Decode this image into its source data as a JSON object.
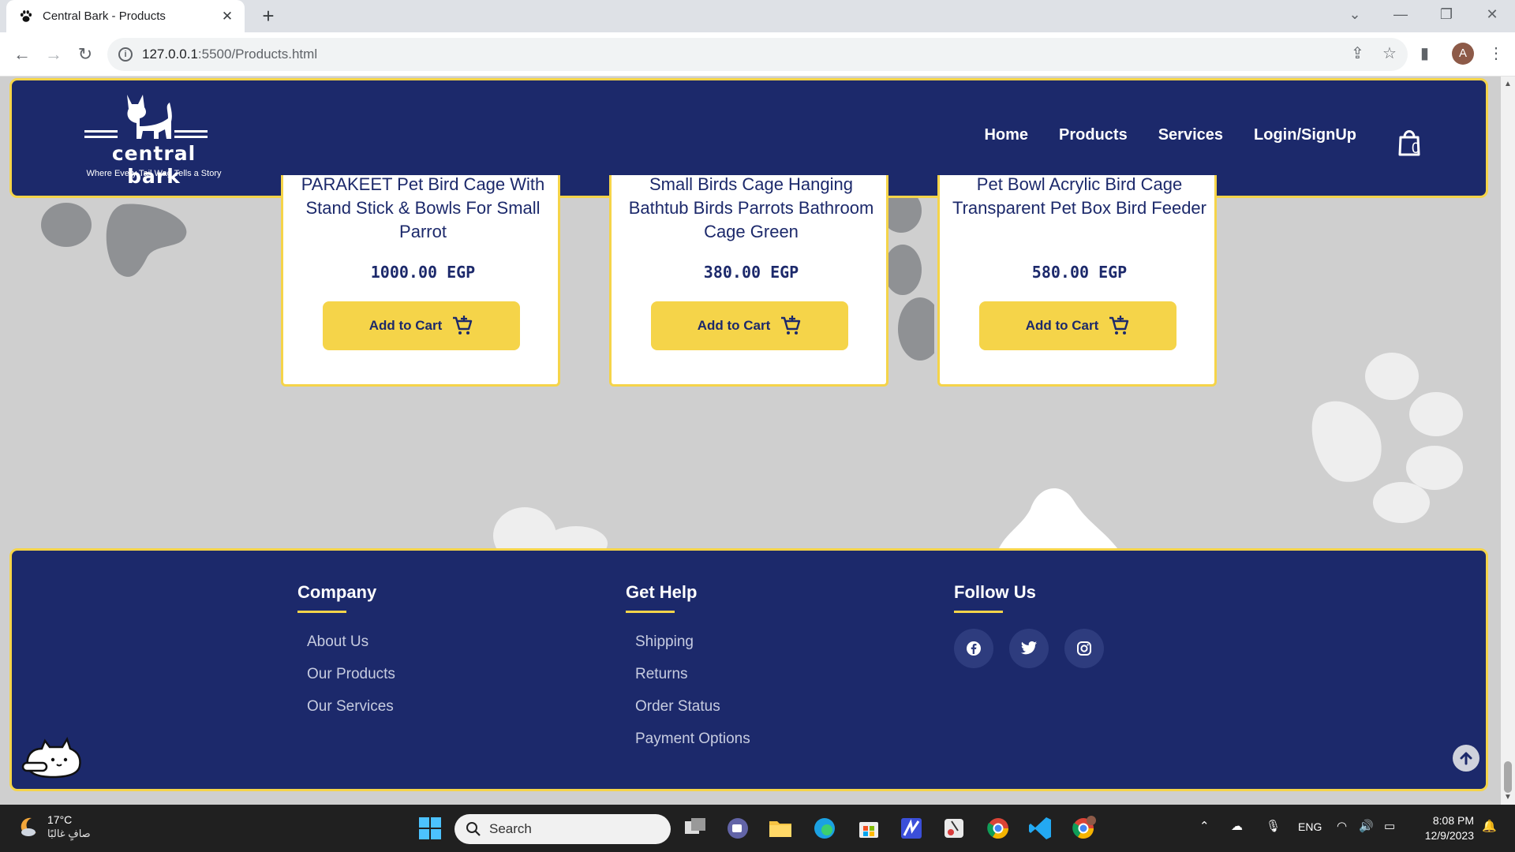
{
  "browser": {
    "tab_title": "Central Bark - Products",
    "url_host": "127.0.0.1",
    "url_path": ":5500/Products.html",
    "profile_initial": "A"
  },
  "header": {
    "logo_name": "central bark",
    "logo_tagline": "Where Every Tail Wag Tells a Story",
    "nav": [
      "Home",
      "Products",
      "Services",
      "Login/SignUp"
    ],
    "cart_count": "0"
  },
  "products": [
    {
      "name": "PARAKEET Pet Bird Cage With Stand Stick & Bowls For Small Parrot",
      "price": "1000.00 EGP",
      "button": "Add to Cart"
    },
    {
      "name": "Small Birds Cage Hanging Bathtub Birds Parrots Bathroom Cage Green",
      "price": "380.00 EGP",
      "button": "Add to Cart"
    },
    {
      "name": "Pet Bowl Acrylic Bird Cage Transparent Pet Box Bird Feeder",
      "price": "580.00 EGP",
      "button": "Add to Cart"
    }
  ],
  "footer": {
    "company": {
      "title": "Company",
      "links": [
        "About Us",
        "Our Products",
        "Our Services"
      ]
    },
    "help": {
      "title": "Get Help",
      "links": [
        "Shipping",
        "Returns",
        "Order Status",
        "Payment Options"
      ]
    },
    "follow": {
      "title": "Follow Us",
      "icons": [
        "facebook-icon",
        "twitter-icon",
        "instagram-icon"
      ]
    }
  },
  "taskbar": {
    "temperature": "17°C",
    "weather": "صافٍ غالبًا",
    "search_placeholder": "Search",
    "language": "ENG",
    "time": "8:08 PM",
    "date": "12/9/2023"
  },
  "colors": {
    "brand_navy": "#1c296b",
    "brand_yellow": "#f5d449",
    "page_bg": "#cfcfcf"
  }
}
